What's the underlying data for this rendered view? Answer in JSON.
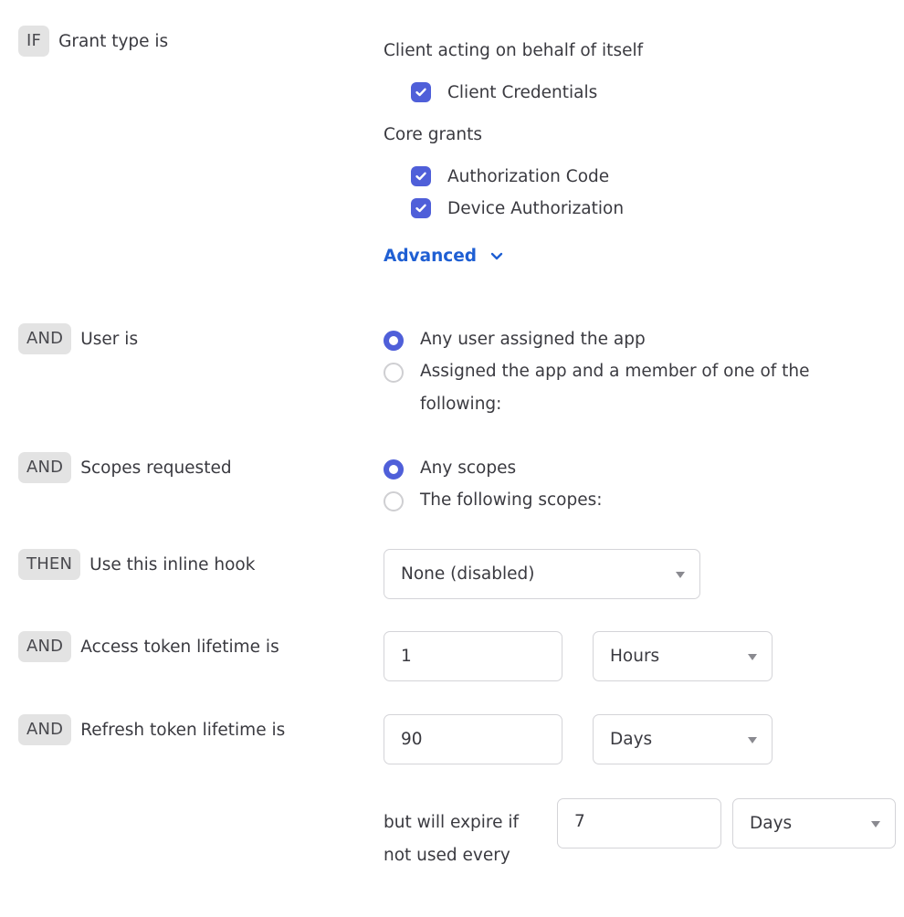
{
  "rules": {
    "grant_type": {
      "badge": "IF",
      "label": "Grant type is"
    },
    "user": {
      "badge": "AND",
      "label": "User is"
    },
    "scopes": {
      "badge": "AND",
      "label": "Scopes requested"
    },
    "inline_hook": {
      "badge": "THEN",
      "label": "Use this inline hook"
    },
    "access_token": {
      "badge": "AND",
      "label": "Access token lifetime is"
    },
    "refresh_token": {
      "badge": "AND",
      "label": "Refresh token lifetime is"
    }
  },
  "grant_types": {
    "group_self": "Client acting on behalf of itself",
    "client_credentials": {
      "label": "Client Credentials",
      "checked": true
    },
    "group_core": "Core grants",
    "authorization_code": {
      "label": "Authorization Code",
      "checked": true
    },
    "device_authorization": {
      "label": "Device Authorization",
      "checked": true
    },
    "advanced_label": "Advanced"
  },
  "user_options": {
    "any_user": {
      "label": "Any user assigned the app",
      "selected": true
    },
    "member_of": {
      "label": "Assigned the app and a member of one of the following:",
      "selected": false
    }
  },
  "scope_options": {
    "any_scopes": {
      "label": "Any scopes",
      "selected": true
    },
    "following_scopes": {
      "label": "The following scopes:",
      "selected": false
    }
  },
  "inline_hook": {
    "selected": "None (disabled)"
  },
  "access_token": {
    "value": "1",
    "unit": "Hours"
  },
  "refresh_token": {
    "value": "90",
    "unit": "Days"
  },
  "refresh_expire": {
    "text": "but will expire if not used every",
    "value": "7",
    "unit": "Days"
  },
  "colors": {
    "accent": "#4f5fd9",
    "link": "#1f5fd3",
    "badge_bg": "#e3e3e3"
  }
}
